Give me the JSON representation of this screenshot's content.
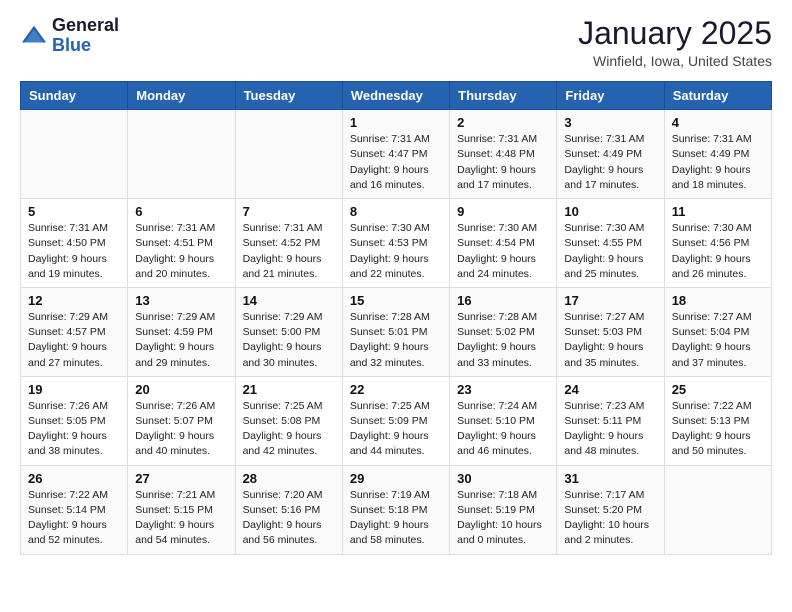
{
  "header": {
    "logo_general": "General",
    "logo_blue": "Blue",
    "month": "January 2025",
    "location": "Winfield, Iowa, United States"
  },
  "calendar": {
    "days_of_week": [
      "Sunday",
      "Monday",
      "Tuesday",
      "Wednesday",
      "Thursday",
      "Friday",
      "Saturday"
    ],
    "weeks": [
      [
        {
          "day": "",
          "info": ""
        },
        {
          "day": "",
          "info": ""
        },
        {
          "day": "",
          "info": ""
        },
        {
          "day": "1",
          "info": "Sunrise: 7:31 AM\nSunset: 4:47 PM\nDaylight: 9 hours\nand 16 minutes."
        },
        {
          "day": "2",
          "info": "Sunrise: 7:31 AM\nSunset: 4:48 PM\nDaylight: 9 hours\nand 17 minutes."
        },
        {
          "day": "3",
          "info": "Sunrise: 7:31 AM\nSunset: 4:49 PM\nDaylight: 9 hours\nand 17 minutes."
        },
        {
          "day": "4",
          "info": "Sunrise: 7:31 AM\nSunset: 4:49 PM\nDaylight: 9 hours\nand 18 minutes."
        }
      ],
      [
        {
          "day": "5",
          "info": "Sunrise: 7:31 AM\nSunset: 4:50 PM\nDaylight: 9 hours\nand 19 minutes."
        },
        {
          "day": "6",
          "info": "Sunrise: 7:31 AM\nSunset: 4:51 PM\nDaylight: 9 hours\nand 20 minutes."
        },
        {
          "day": "7",
          "info": "Sunrise: 7:31 AM\nSunset: 4:52 PM\nDaylight: 9 hours\nand 21 minutes."
        },
        {
          "day": "8",
          "info": "Sunrise: 7:30 AM\nSunset: 4:53 PM\nDaylight: 9 hours\nand 22 minutes."
        },
        {
          "day": "9",
          "info": "Sunrise: 7:30 AM\nSunset: 4:54 PM\nDaylight: 9 hours\nand 24 minutes."
        },
        {
          "day": "10",
          "info": "Sunrise: 7:30 AM\nSunset: 4:55 PM\nDaylight: 9 hours\nand 25 minutes."
        },
        {
          "day": "11",
          "info": "Sunrise: 7:30 AM\nSunset: 4:56 PM\nDaylight: 9 hours\nand 26 minutes."
        }
      ],
      [
        {
          "day": "12",
          "info": "Sunrise: 7:29 AM\nSunset: 4:57 PM\nDaylight: 9 hours\nand 27 minutes."
        },
        {
          "day": "13",
          "info": "Sunrise: 7:29 AM\nSunset: 4:59 PM\nDaylight: 9 hours\nand 29 minutes."
        },
        {
          "day": "14",
          "info": "Sunrise: 7:29 AM\nSunset: 5:00 PM\nDaylight: 9 hours\nand 30 minutes."
        },
        {
          "day": "15",
          "info": "Sunrise: 7:28 AM\nSunset: 5:01 PM\nDaylight: 9 hours\nand 32 minutes."
        },
        {
          "day": "16",
          "info": "Sunrise: 7:28 AM\nSunset: 5:02 PM\nDaylight: 9 hours\nand 33 minutes."
        },
        {
          "day": "17",
          "info": "Sunrise: 7:27 AM\nSunset: 5:03 PM\nDaylight: 9 hours\nand 35 minutes."
        },
        {
          "day": "18",
          "info": "Sunrise: 7:27 AM\nSunset: 5:04 PM\nDaylight: 9 hours\nand 37 minutes."
        }
      ],
      [
        {
          "day": "19",
          "info": "Sunrise: 7:26 AM\nSunset: 5:05 PM\nDaylight: 9 hours\nand 38 minutes."
        },
        {
          "day": "20",
          "info": "Sunrise: 7:26 AM\nSunset: 5:07 PM\nDaylight: 9 hours\nand 40 minutes."
        },
        {
          "day": "21",
          "info": "Sunrise: 7:25 AM\nSunset: 5:08 PM\nDaylight: 9 hours\nand 42 minutes."
        },
        {
          "day": "22",
          "info": "Sunrise: 7:25 AM\nSunset: 5:09 PM\nDaylight: 9 hours\nand 44 minutes."
        },
        {
          "day": "23",
          "info": "Sunrise: 7:24 AM\nSunset: 5:10 PM\nDaylight: 9 hours\nand 46 minutes."
        },
        {
          "day": "24",
          "info": "Sunrise: 7:23 AM\nSunset: 5:11 PM\nDaylight: 9 hours\nand 48 minutes."
        },
        {
          "day": "25",
          "info": "Sunrise: 7:22 AM\nSunset: 5:13 PM\nDaylight: 9 hours\nand 50 minutes."
        }
      ],
      [
        {
          "day": "26",
          "info": "Sunrise: 7:22 AM\nSunset: 5:14 PM\nDaylight: 9 hours\nand 52 minutes."
        },
        {
          "day": "27",
          "info": "Sunrise: 7:21 AM\nSunset: 5:15 PM\nDaylight: 9 hours\nand 54 minutes."
        },
        {
          "day": "28",
          "info": "Sunrise: 7:20 AM\nSunset: 5:16 PM\nDaylight: 9 hours\nand 56 minutes."
        },
        {
          "day": "29",
          "info": "Sunrise: 7:19 AM\nSunset: 5:18 PM\nDaylight: 9 hours\nand 58 minutes."
        },
        {
          "day": "30",
          "info": "Sunrise: 7:18 AM\nSunset: 5:19 PM\nDaylight: 10 hours\nand 0 minutes."
        },
        {
          "day": "31",
          "info": "Sunrise: 7:17 AM\nSunset: 5:20 PM\nDaylight: 10 hours\nand 2 minutes."
        },
        {
          "day": "",
          "info": ""
        }
      ]
    ]
  }
}
